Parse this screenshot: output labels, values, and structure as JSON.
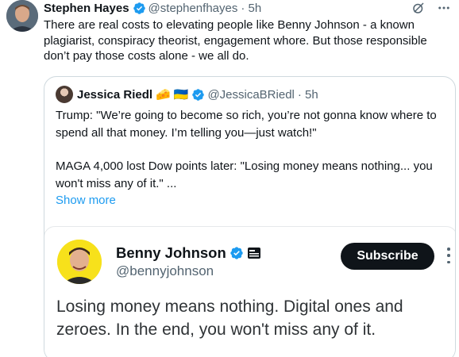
{
  "tweet": {
    "author_name": "Stephen Hayes",
    "author_handle": "@stephenfhayes",
    "time": "· 5h",
    "text": "There are real costs to elevating people like Benny Johnson - a known plagiarist, conspiracy theorist, engagement whore. But those responsible don’t pay those costs alone - we all do."
  },
  "quote": {
    "author_name": "Jessica Riedl",
    "emojis": [
      "🧀",
      "🇺🇦"
    ],
    "author_handle": "@JessicaBRiedl",
    "time": "· 5h",
    "line1": "Trump: \"We’re going to become so rich, you’re not gonna know where to spend all that money. I’m telling you—just watch!\"",
    "line2": "MAGA 4,000 lost Dow points later: \"Losing money means nothing... you won't miss any of it.\" ...",
    "show_more": "Show more"
  },
  "embed": {
    "name": "Benny Johnson",
    "handle": "@bennyjohnson",
    "subscribe_label": "Subscribe",
    "text": "Losing money means nothing. Digital ones and zeroes. In the end, you won't miss any of it."
  },
  "colors": {
    "verified_blue": "#1d9bf0",
    "link_blue": "#1d9bf0",
    "subscribe_bg": "#0f1419",
    "embed_avatar_yellow": "#f7e11b"
  },
  "icons": [
    "verified-badge-icon",
    "grok-icon",
    "more-options-icon",
    "news-badge-icon",
    "kebab-menu-icon"
  ]
}
